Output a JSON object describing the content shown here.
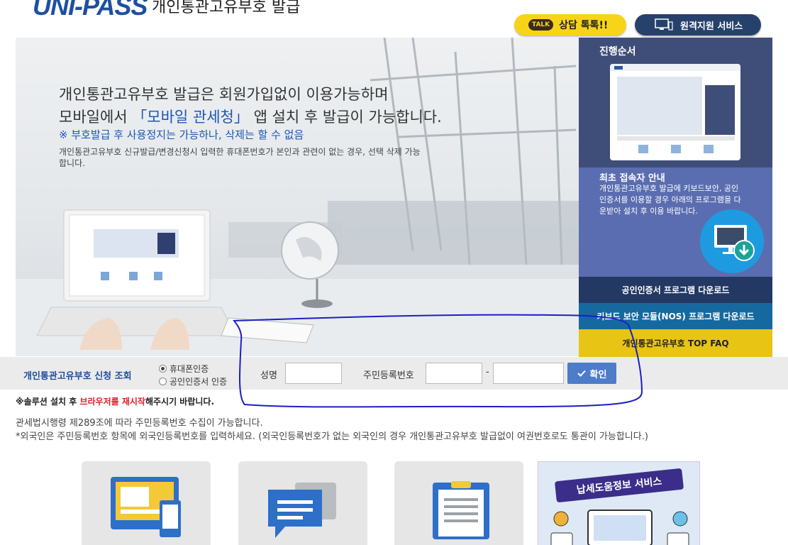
{
  "header": {
    "logo_text": "UNI-PASS",
    "subtitle": "개인통관고유부호 발급",
    "talk_badge": "TALK",
    "talk_label": "상담 톡톡!!",
    "remote_label": "원격지원 서비스"
  },
  "hero": {
    "line1": "개인통관고유부호 발급은 회원가입없이 이용가능하며",
    "line2_pre": "모바일에서 ",
    "line2_hl": "「모바일 관세청」",
    "line2_post": " 앱 설치 후 발급이 가능합니다.",
    "note": "※ 부호발급 후 사용정지는 가능하나, 삭제는 할 수 없음",
    "desc": "개인통관고유부호 신규발급/변경신청시 입력한 휴대폰번호가 본인과 관련이 없는 경우, 선택 삭제 가능합니다."
  },
  "panel": {
    "process_title": "진행순서",
    "first_title": "최초 접속자 안내",
    "first_desc": "개인통관고유부호 발급에 키보드보안, 공인인증서를 이용할 경우 아래의 프로그램을 다운받아 설치 후 이용 바랍니다.",
    "download_cert": "공인인증서 프로그램 다운로드",
    "download_nos": "키보드 보안 모듈(NOS) 프로그램 다운로드",
    "faq": "개인통관고유부호 TOP FAQ"
  },
  "search": {
    "title": "개인통관고유부호 신청 조회",
    "radio_phone": "휴대폰인증",
    "radio_cert": "공인인증서 인증",
    "name_label": "성명",
    "rrn_label": "주민등록번호",
    "dash": "-",
    "confirm": "확인"
  },
  "notices": {
    "n1_pre": "※솔루션 설치 후 ",
    "n1_red": "브라우저를 재시작",
    "n1_post": "해주시기 바랍니다.",
    "n2": "관세법시행령 제289조에 따라 주민등록번호 수집이 가능합니다.",
    "n3": "*외국인은 주민등록번호 항목에 외국인등록번호를 입력하세요.   (외국인등록번호가 없는 외국인의 경우 개인통관고유부호 발급없이 여권번호로도 통관이 가능합니다.)"
  },
  "banner": {
    "title": "납세도움정보 서비스"
  },
  "colors": {
    "brand_blue": "#1e4fa0",
    "accent_yellow": "#f7d417",
    "annotation": "#1a1fc7"
  }
}
